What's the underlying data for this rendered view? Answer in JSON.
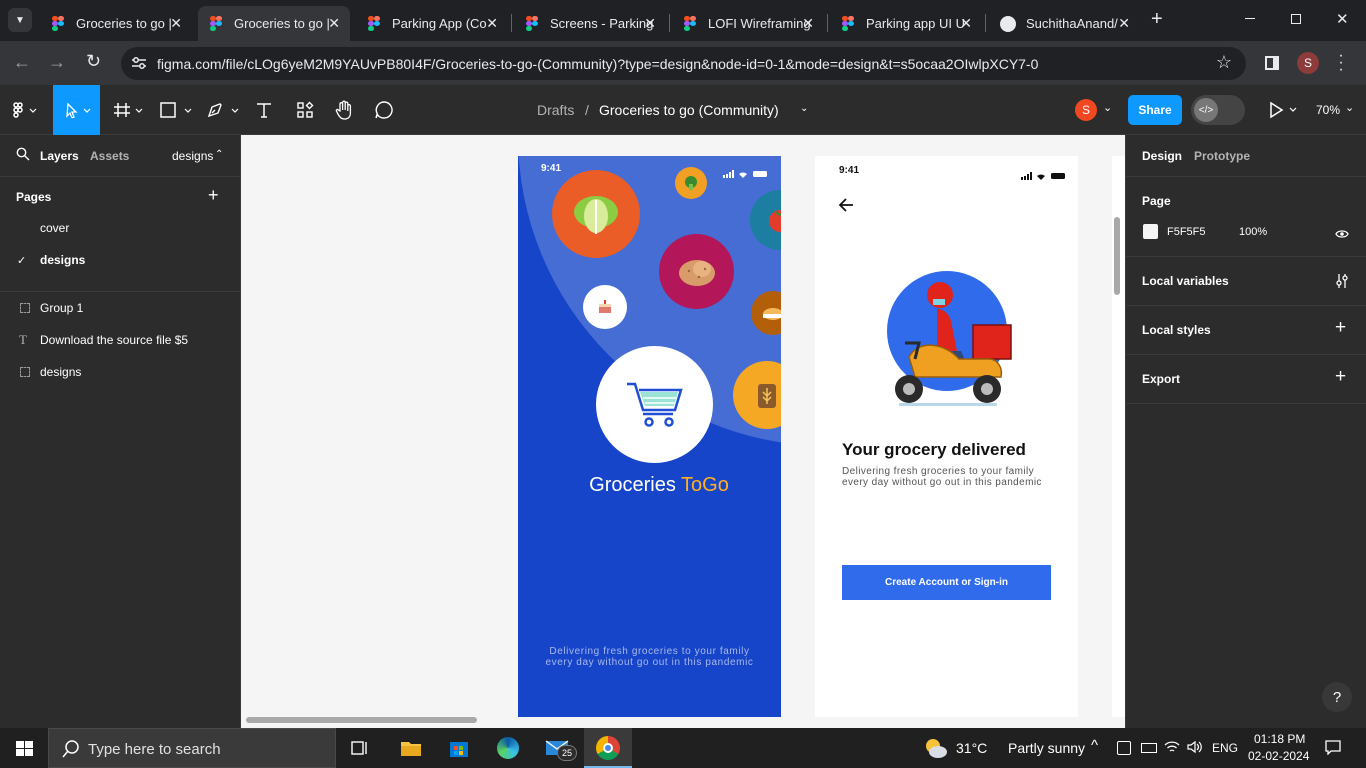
{
  "browser": {
    "tabs": [
      {
        "title": "Groceries to go |",
        "active": false
      },
      {
        "title": "Groceries to go |",
        "active": true
      },
      {
        "title": "Parking App (Co",
        "active": false
      },
      {
        "title": "Screens - Parking",
        "active": false
      },
      {
        "title": "LOFI Wireframing",
        "active": false
      },
      {
        "title": "Parking app UI U",
        "active": false
      },
      {
        "title": "SuchithaAnand/",
        "active": false
      }
    ],
    "url": "figma.com/file/cLOg6yeM2M9YAUvPB80I4F/Groceries-to-go-(Community)?type=design&node-id=0-1&mode=design&t=s5ocaa2OIwlpXCY7-0",
    "profile_initial": "S"
  },
  "toolbar": {
    "breadcrumb_root": "Drafts",
    "breadcrumb_sep": "/",
    "file_name": "Groceries to go (Community)",
    "avatar_initial": "S",
    "share_label": "Share",
    "zoom": "70%"
  },
  "left_panel": {
    "tab_layers": "Layers",
    "tab_assets": "Assets",
    "page_dropdown": "designs",
    "pages_heading": "Pages",
    "pages": [
      {
        "name": "cover",
        "checked": false
      },
      {
        "name": "designs",
        "checked": true
      }
    ],
    "layers": [
      {
        "name": "Group 1",
        "icon": "frame-icon"
      },
      {
        "name": "Download the source file $5",
        "icon": "text-icon"
      },
      {
        "name": "designs",
        "icon": "frame-icon"
      }
    ]
  },
  "right_panel": {
    "tab_design": "Design",
    "tab_prototype": "Prototype",
    "page_heading": "Page",
    "page_color": "F5F5F5",
    "page_opacity": "100%",
    "local_variables": "Local variables",
    "local_styles": "Local styles",
    "export": "Export",
    "help": "?"
  },
  "canvas": {
    "background": "#F5F5F5",
    "splash": {
      "time": "9:41",
      "brand_a": "Groceries",
      "brand_b": "ToGo",
      "tagline_1": "Delivering fresh groceries to your family",
      "tagline_2": "every day without go out in this pandemic",
      "bg_color": "#1745C9",
      "accent": "#FFB020"
    },
    "onboard": {
      "time": "9:41",
      "heading": "Your grocery delivered",
      "desc_1": "Delivering fresh groceries to your family",
      "desc_2": "every day without go out in  this pandemic",
      "button": "Create Account or Sign-in",
      "button_color": "#2F6BEA"
    }
  },
  "taskbar": {
    "search_placeholder": "Type here to search",
    "weather_temp": "31°C",
    "weather_text": "Partly sunny",
    "lang": "ENG",
    "time": "01:18 PM",
    "date": "02-02-2024",
    "mail_badge": "25"
  }
}
